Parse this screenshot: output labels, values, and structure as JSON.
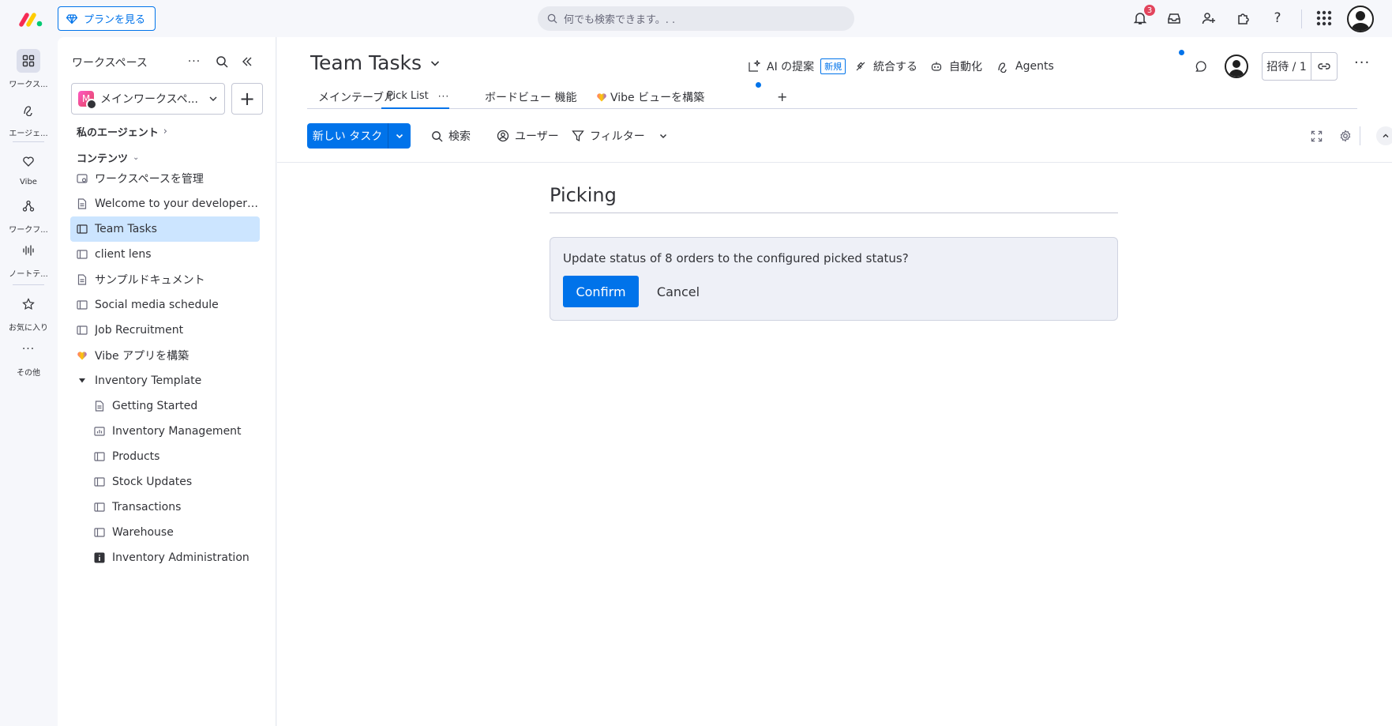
{
  "topbar": {
    "plan_button": "プランを見る",
    "search_placeholder": "何でも検索できます。. .",
    "notification_count": "3"
  },
  "rail": {
    "items": [
      {
        "label": "ワークス..."
      },
      {
        "label": "エージェ..."
      },
      {
        "label": "Vibe"
      },
      {
        "label": "ワークフ..."
      },
      {
        "label": "ノートテ..."
      },
      {
        "label": "お気に入り"
      },
      {
        "label": "その他"
      }
    ]
  },
  "sidebar": {
    "workspace_header": "ワークスペース",
    "workspace_name": "メインワークスペ...",
    "workspace_initial": "M",
    "my_agents": "私のエージェント",
    "contents": "コンテンツ",
    "items": [
      {
        "label": "ワークスペースを管理"
      },
      {
        "label": "Welcome to your developer acc..."
      },
      {
        "label": "Team Tasks"
      },
      {
        "label": "client lens"
      },
      {
        "label": "サンプルドキュメント"
      },
      {
        "label": "Social media schedule"
      },
      {
        "label": "Job Recruitment"
      },
      {
        "label": "Vibe アプリを構築"
      },
      {
        "label": "Inventory Template"
      },
      {
        "label": "Getting Started"
      },
      {
        "label": "Inventory Management"
      },
      {
        "label": "Products"
      },
      {
        "label": "Stock Updates"
      },
      {
        "label": "Transactions"
      },
      {
        "label": "Warehouse"
      },
      {
        "label": "Inventory Administration"
      }
    ]
  },
  "header": {
    "title": "Team Tasks",
    "ai_suggest": "AI の提案",
    "new_tag": "新規",
    "integrate": "統合する",
    "automate": "自動化",
    "agents": "Agents",
    "invite": "招待 / 1"
  },
  "tabs": [
    {
      "label": "メインテーブル"
    },
    {
      "label": "Pick List"
    },
    {
      "label": "ボードビュー 機能"
    },
    {
      "label": "Vibe ビューを構築"
    },
    {
      "label": "+"
    }
  ],
  "toolbar": {
    "new_task": "新しい タスク",
    "search": "検索",
    "user": "ユーザー",
    "filter": "フィルター"
  },
  "picking": {
    "title": "Picking",
    "message": "Update status of 8 orders to the configured picked status?",
    "confirm": "Confirm",
    "cancel": "Cancel"
  },
  "colors": {
    "accent": "#0073ea",
    "active_item": "#cce5ff",
    "badge": "#e2445c"
  }
}
